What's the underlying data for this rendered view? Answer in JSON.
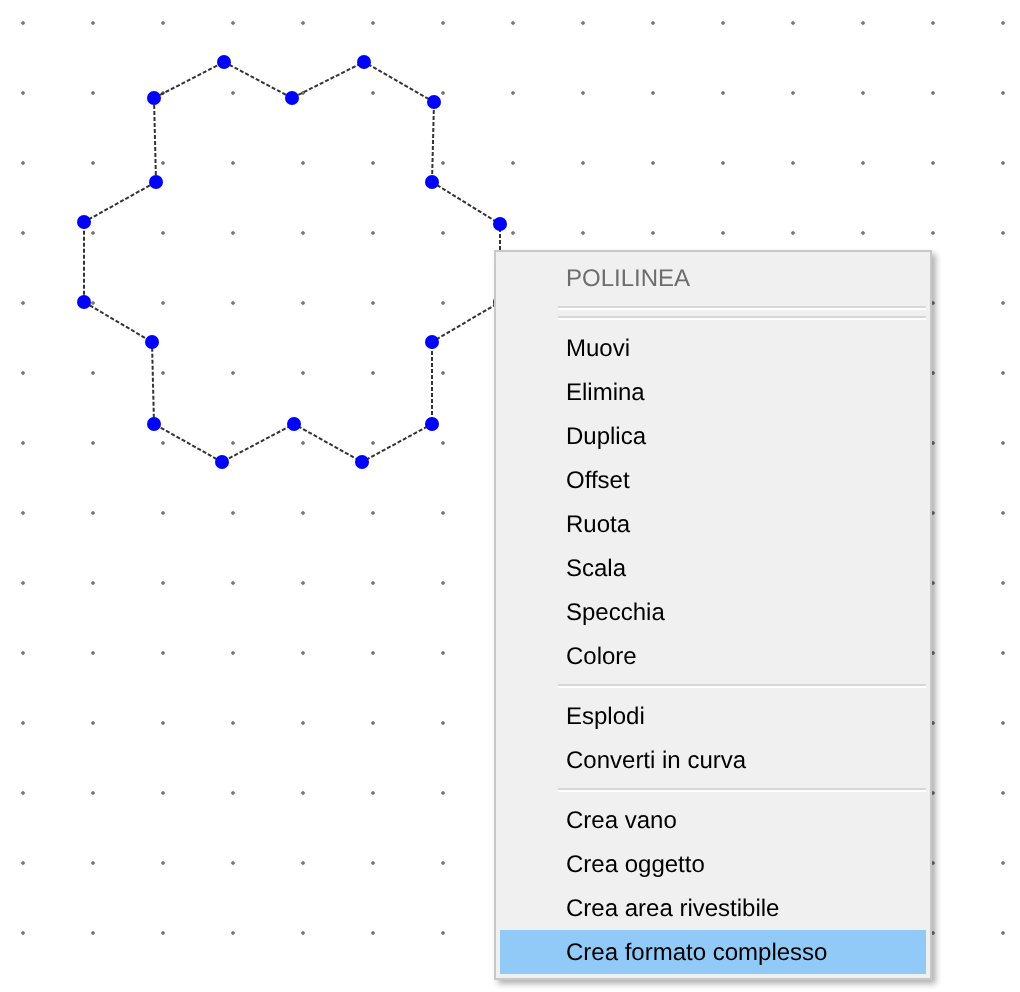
{
  "context_menu": {
    "title": "POLILINEA",
    "groups": [
      [
        {
          "label": "Muovi",
          "selected": false
        },
        {
          "label": "Elimina",
          "selected": false
        },
        {
          "label": "Duplica",
          "selected": false
        },
        {
          "label": "Offset",
          "selected": false
        },
        {
          "label": "Ruota",
          "selected": false
        },
        {
          "label": "Scala",
          "selected": false
        },
        {
          "label": "Specchia",
          "selected": false
        },
        {
          "label": "Colore",
          "selected": false
        }
      ],
      [
        {
          "label": "Esplodi",
          "selected": false
        },
        {
          "label": "Converti in curva",
          "selected": false
        }
      ],
      [
        {
          "label": "Crea vano",
          "selected": false
        },
        {
          "label": "Crea oggetto",
          "selected": false
        },
        {
          "label": "Crea area rivestibile",
          "selected": false
        },
        {
          "label": "Crea formato complesso",
          "selected": true
        }
      ]
    ]
  }
}
